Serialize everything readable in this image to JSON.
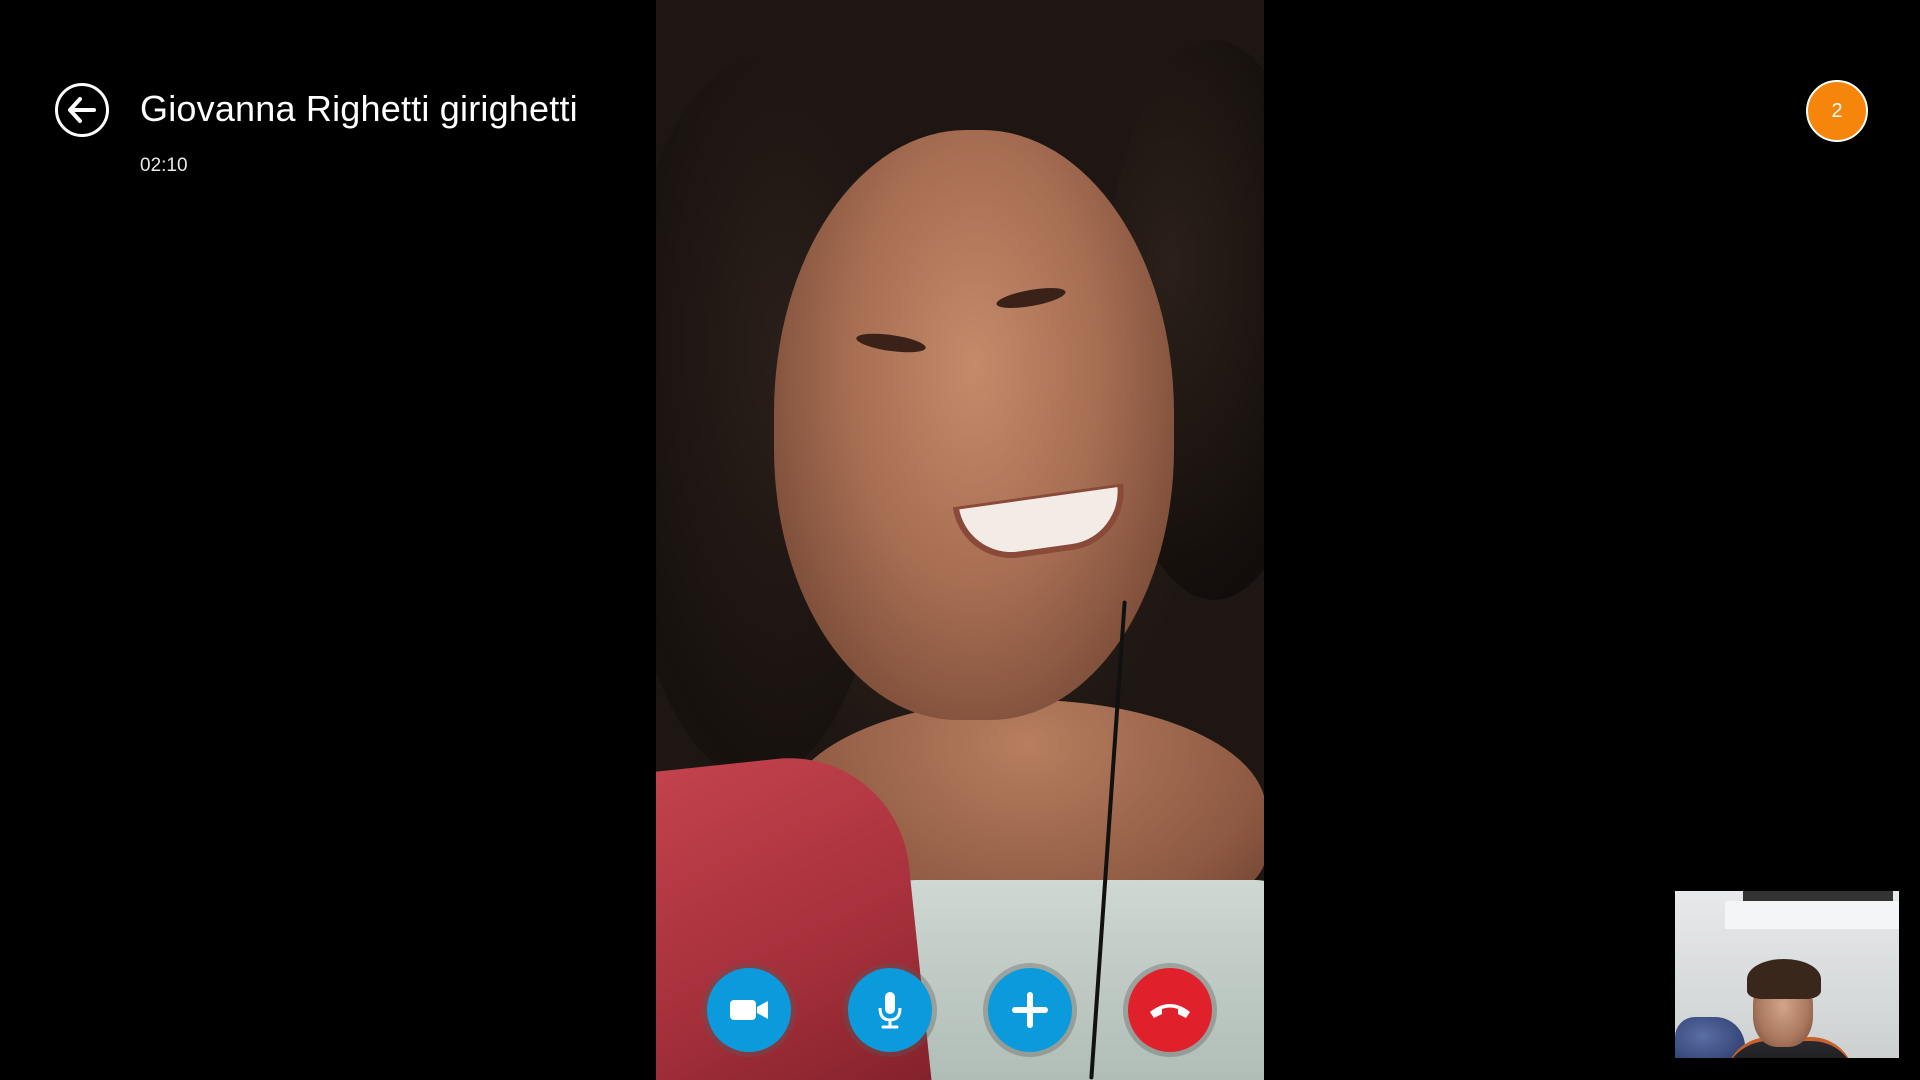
{
  "call": {
    "contact_name": "Giovanna Righetti girighetti",
    "duration": "02:10",
    "participants_count": "2"
  },
  "controls": {
    "video_icon": "video-camera-icon",
    "mic_icon": "microphone-icon",
    "add_icon": "plus-icon",
    "end_icon": "phone-hangup-icon"
  },
  "colors": {
    "accent_blue": "#0b9bdd",
    "end_call_red": "#e0212c",
    "badge_orange": "#f5860b"
  }
}
